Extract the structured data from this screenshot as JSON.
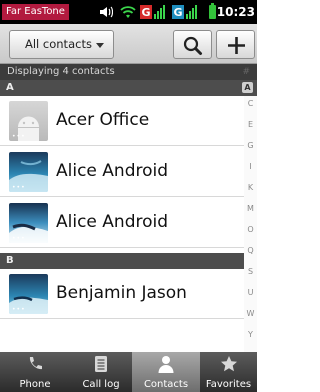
{
  "status_bar": {
    "carrier": "Far EasTone",
    "time": "10:23"
  },
  "action_bar": {
    "filter_label": "All contacts"
  },
  "header": {
    "count_text": "Displaying 4 contacts",
    "hash": "#"
  },
  "sections": [
    {
      "letter": "A",
      "badge": "A"
    },
    {
      "letter": "B"
    }
  ],
  "contacts": [
    {
      "name": "Acer Office"
    },
    {
      "name": "Alice Android"
    },
    {
      "name": "Alice Android"
    },
    {
      "name": "Benjamin Jason"
    }
  ],
  "index_letters": [
    "C",
    "E",
    "G",
    "I",
    "K",
    "M",
    "O",
    "Q",
    "S",
    "U",
    "W",
    "Y"
  ],
  "tabs": [
    {
      "label": "Phone"
    },
    {
      "label": "Call log"
    },
    {
      "label": "Contacts",
      "selected": true
    },
    {
      "label": "Favorites"
    }
  ]
}
